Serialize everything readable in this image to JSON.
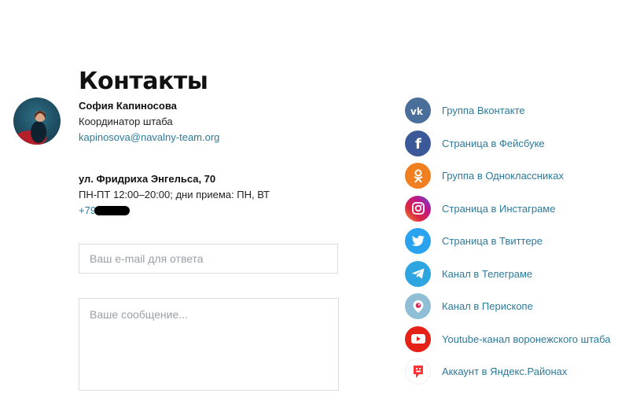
{
  "title": "Контакты",
  "person": {
    "name": "София Капиносова",
    "role": "Координатор штаба",
    "email": "kapinosova@navalny-team.org"
  },
  "office": {
    "address": "ул. Фридриха Энгельса, 70",
    "hours": "ПН-ПТ 12:00–20:00; дни приема: ПН, ВТ",
    "phone": "+79371"
  },
  "form": {
    "email_placeholder": "Ваш e-mail для ответа",
    "message_placeholder": "Ваше сообщение..."
  },
  "social": [
    {
      "label": "Группа Вконтакте",
      "icon": "vk-icon",
      "color": "#4a6f9a"
    },
    {
      "label": "Страница в Фейсбуке",
      "icon": "facebook-icon",
      "color": "#3b5998"
    },
    {
      "label": "Группа в Одноклассниках",
      "icon": "odnoklassniki-icon",
      "color": "#f07f20"
    },
    {
      "label": "Страница в Инстаграме",
      "icon": "instagram-icon",
      "color": "#c13584"
    },
    {
      "label": "Страница в Твиттере",
      "icon": "twitter-icon",
      "color": "#2aa3ef"
    },
    {
      "label": "Канал в Телеграме",
      "icon": "telegram-icon",
      "color": "#2ca5e0"
    },
    {
      "label": "Канал в Перископе",
      "icon": "periscope-icon",
      "color": "#8ebfd6"
    },
    {
      "label": "Youtube-канал воронежского штаба",
      "icon": "youtube-icon",
      "color": "#e62117"
    },
    {
      "label": "Аккаунт в Яндекс.Районах",
      "icon": "yandex-rayony-icon",
      "color": "#f33"
    }
  ]
}
